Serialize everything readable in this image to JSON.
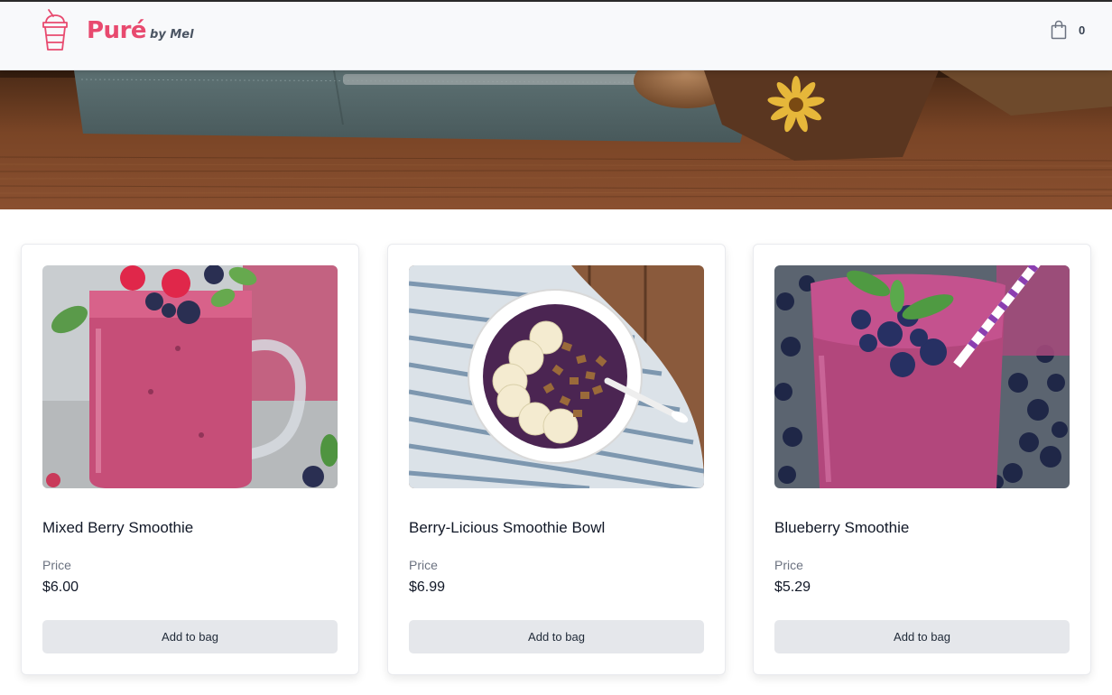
{
  "header": {
    "brand_name": "Puré",
    "brand_byline": "by Mel",
    "logo_icon": "smoothie-cup-icon",
    "cart_icon": "shopping-bag-icon",
    "cart_count": "0",
    "brand_color": "#e84a6f"
  },
  "hero": {
    "image": "wooden-table-with-napkin-spoon-and-flower"
  },
  "products": [
    {
      "name": "Mixed Berry Smoothie",
      "price_label": "Price",
      "price": "$6.00",
      "button_label": "Add to bag",
      "image": "mixed-berry-smoothie-jar-photo"
    },
    {
      "name": "Berry-Licious Smoothie Bowl",
      "price_label": "Price",
      "price": "$6.99",
      "button_label": "Add to bag",
      "image": "acai-smoothie-bowl-photo"
    },
    {
      "name": "Blueberry Smoothie",
      "price_label": "Price",
      "price": "$5.29",
      "button_label": "Add to bag",
      "image": "blueberry-smoothie-glass-photo"
    }
  ]
}
